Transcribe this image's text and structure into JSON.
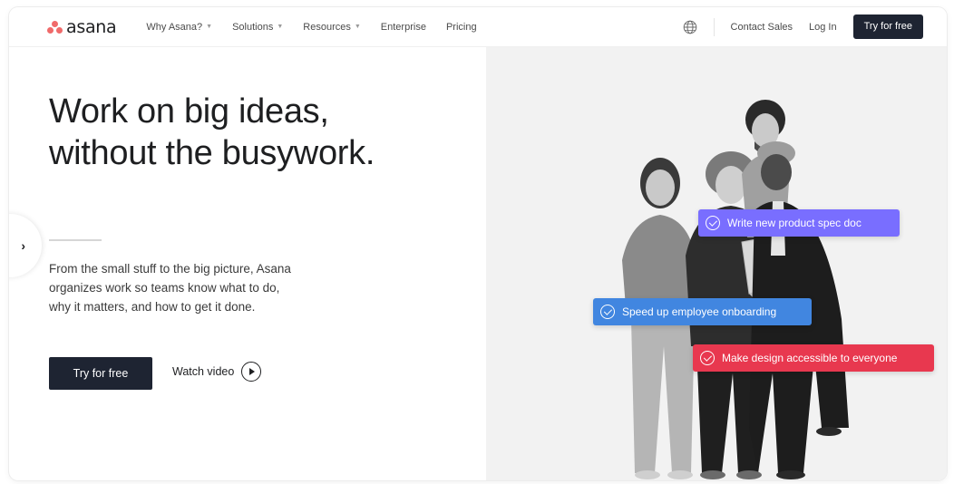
{
  "nav": {
    "logo_text": "asana",
    "links": [
      {
        "label": "Why Asana?",
        "dropdown": true
      },
      {
        "label": "Solutions",
        "dropdown": true
      },
      {
        "label": "Resources",
        "dropdown": true
      },
      {
        "label": "Enterprise",
        "dropdown": false
      },
      {
        "label": "Pricing",
        "dropdown": false
      }
    ],
    "globe_icon": "globe-icon",
    "contact_label": "Contact Sales",
    "login_label": "Log In",
    "cta_label": "Try for free"
  },
  "hero": {
    "headline_lines": [
      "Work on big ideas,",
      "without the busywork."
    ],
    "subtext_lines": [
      "From the small stuff to the big picture, Asana",
      "organizes work so teams know what to do,",
      "why it matters, and how to get it done."
    ],
    "cta_label": "Try for free",
    "watch_label": "Watch video",
    "side_arrow": "›"
  },
  "tasks": [
    {
      "label": "Write new product spec doc",
      "color": "#796eff"
    },
    {
      "label": "Speed up employee onboarding",
      "color": "#4186e0"
    },
    {
      "label": "Make design accessible to everyone",
      "color": "#e8384f"
    }
  ],
  "colors": {
    "brand": "#f06a6a",
    "cta_dark": "#1e2432",
    "image_bg": "#f2f2f2"
  }
}
